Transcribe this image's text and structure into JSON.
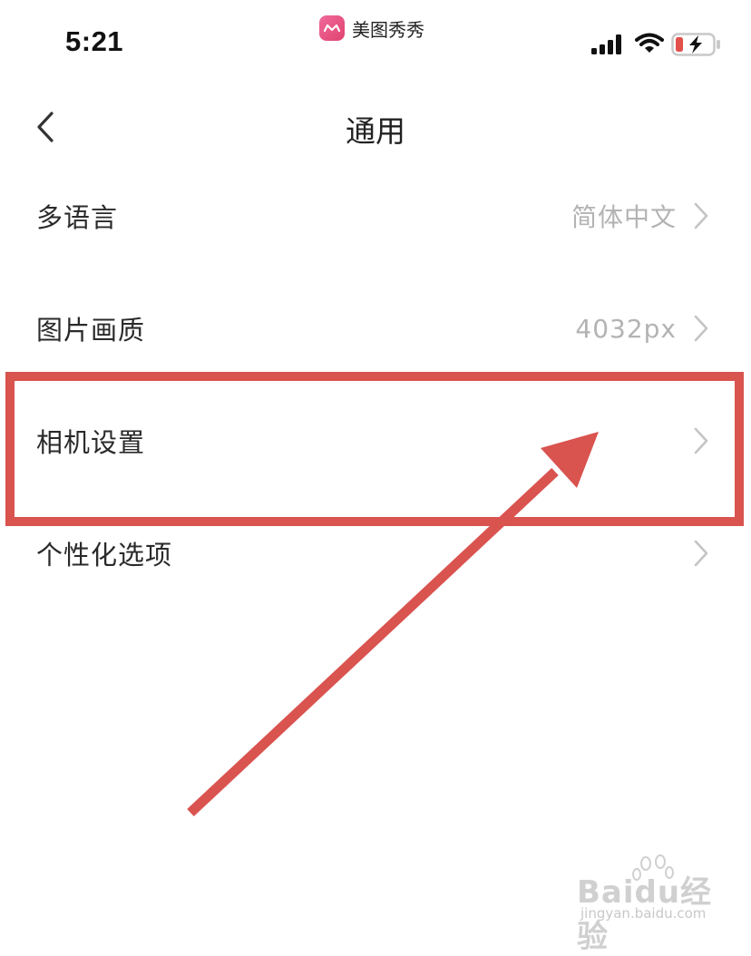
{
  "status_bar": {
    "time": "5:21",
    "app_name": "美图秀秀"
  },
  "header": {
    "title": "通用",
    "back_icon": "chevron-left-icon"
  },
  "settings": {
    "items": [
      {
        "label": "多语言",
        "value": "简体中文"
      },
      {
        "label": "图片画质",
        "value": "4032px"
      },
      {
        "label": "相机设置",
        "value": ""
      },
      {
        "label": "个性化选项",
        "value": ""
      }
    ]
  },
  "annotation": {
    "color": "#d9534f",
    "highlighted_item": "相机设置"
  },
  "watermark": {
    "brand": "Baidu经验",
    "url": "jingyan.baidu.com"
  }
}
